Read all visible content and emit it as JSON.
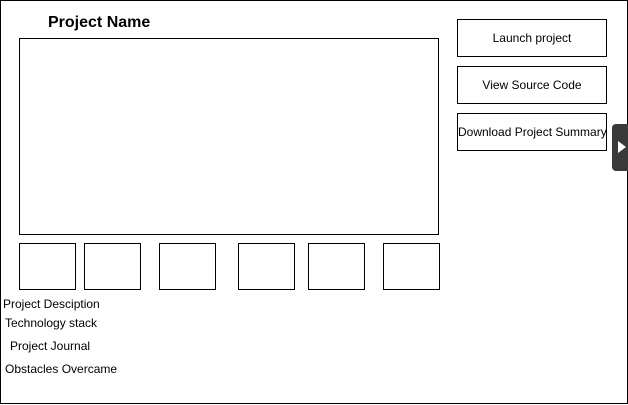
{
  "page": {
    "title": "Project Name"
  },
  "actions": {
    "launch_label": "Launch project",
    "view_source_label": "View Source Code",
    "download_summary_label": "Download Project Summary"
  },
  "sections": [
    "Project Desciption",
    "Technology stack",
    "Project Journal",
    "Obstacles Overcame"
  ],
  "panel_toggle": {
    "icon": "play-arrow-icon"
  }
}
